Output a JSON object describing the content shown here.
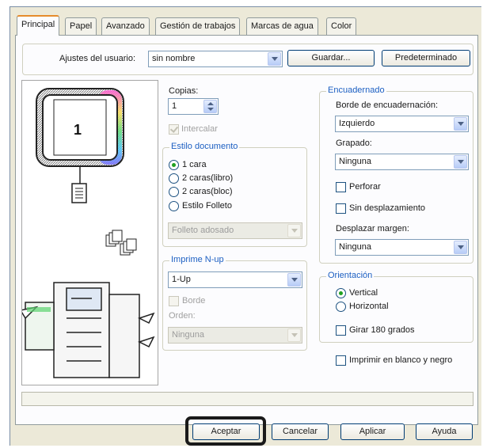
{
  "tabs": [
    "Principal",
    "Papel",
    "Avanzado",
    "Gestión de trabajos",
    "Marcas de agua",
    "Color"
  ],
  "user_settings": {
    "label": "Ajustes del usuario:",
    "value": "sin nombre",
    "save_label": "Guardar...",
    "default_label": "Predeterminado"
  },
  "preview": {
    "page_number": "1"
  },
  "copies": {
    "label": "Copias:",
    "value": "1",
    "collate_label": "Intercalar",
    "collate_checked": true
  },
  "doc_style": {
    "legend": "Estilo documento",
    "options": [
      "1 cara",
      "2 caras(libro)",
      "2 caras(bloc)",
      "Estilo Folleto"
    ],
    "selected": "1 cara",
    "booklet_value": "Folleto adosado"
  },
  "nup": {
    "legend": "Imprime N-up",
    "value": "1-Up",
    "border_label": "Borde",
    "order_label": "Orden:",
    "order_value": "Ninguna"
  },
  "binding": {
    "legend": "Encuadernado",
    "edge_label": "Borde de encuadernación:",
    "edge_value": "Izquierdo",
    "staple_label": "Grapado:",
    "staple_value": "Ninguna",
    "punch_label": "Perforar",
    "no_offset_label": "Sin desplazamiento",
    "margin_label": "Desplazar margen:",
    "margin_value": "Ninguna"
  },
  "orientation": {
    "legend": "Orientación",
    "options": [
      "Vertical",
      "Horizontal"
    ],
    "selected": "Vertical",
    "rotate_label": "Girar 180 grados"
  },
  "bw_label": "Imprimir en blanco y negro",
  "footer": {
    "ok": "Aceptar",
    "cancel": "Cancelar",
    "apply": "Aplicar",
    "help": "Ayuda"
  },
  "colors": {
    "tab_accent": "#e68b2c",
    "group_legend": "#1c5fc2",
    "check_mark": "#21a121",
    "callout_border": "#1a1a1a"
  }
}
